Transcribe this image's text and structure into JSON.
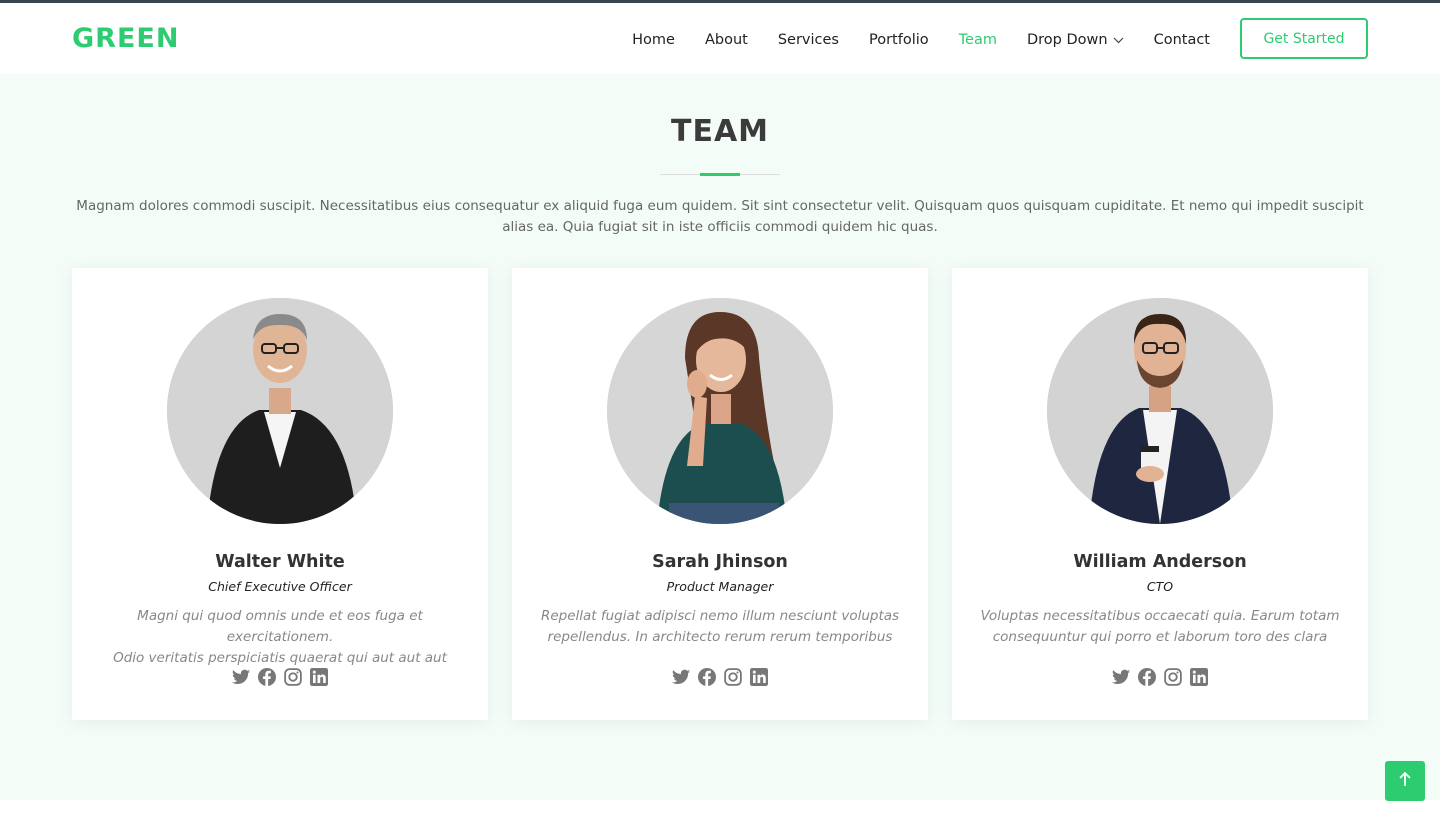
{
  "brand": {
    "logo": "GREEN",
    "accent_color": "#2ecc71"
  },
  "nav": {
    "items": [
      {
        "label": "Home",
        "active": false
      },
      {
        "label": "About",
        "active": false
      },
      {
        "label": "Services",
        "active": false
      },
      {
        "label": "Portfolio",
        "active": false
      },
      {
        "label": "Team",
        "active": true
      },
      {
        "label": "Drop Down",
        "active": false,
        "dropdown_icon": "chevron-down-icon"
      },
      {
        "label": "Contact",
        "active": false
      }
    ],
    "cta_label": "Get Started"
  },
  "team": {
    "title": "TEAM",
    "description": "Magnam dolores commodi suscipit. Necessitatibus eius consequatur ex aliquid fuga eum quidem. Sit sint consectetur velit. Quisquam quos quisquam cupiditate. Et nemo qui impedit suscipit alias ea. Quia fugiat sit in iste officiis commodi quidem hic quas.",
    "members": [
      {
        "name": "Walter White",
        "role": "Chief Executive Officer",
        "bio_line1": "Magni qui quod omnis unde et eos fuga et exercitationem.",
        "bio_line2": "Odio veritatis perspiciatis quaerat qui aut aut aut",
        "social": [
          "twitter-icon",
          "facebook-icon",
          "instagram-icon",
          "linkedin-icon"
        ]
      },
      {
        "name": "Sarah Jhinson",
        "role": "Product Manager",
        "bio_line1": "Repellat fugiat adipisci nemo illum nesciunt voluptas",
        "bio_line2": "repellendus. In architecto rerum rerum temporibus",
        "social": [
          "twitter-icon",
          "facebook-icon",
          "instagram-icon",
          "linkedin-icon"
        ]
      },
      {
        "name": "William Anderson",
        "role": "CTO",
        "bio_line1": "Voluptas necessitatibus occaecati quia. Earum totam",
        "bio_line2": "consequuntur qui porro et laborum toro des clara",
        "social": [
          "twitter-icon",
          "facebook-icon",
          "instagram-icon",
          "linkedin-icon"
        ]
      }
    ]
  },
  "back_to_top_icon": "arrow-up-icon",
  "colors": {
    "section_bg": "#f3fcf7",
    "header_border": "#37474f",
    "icon_gray": "#777777"
  }
}
